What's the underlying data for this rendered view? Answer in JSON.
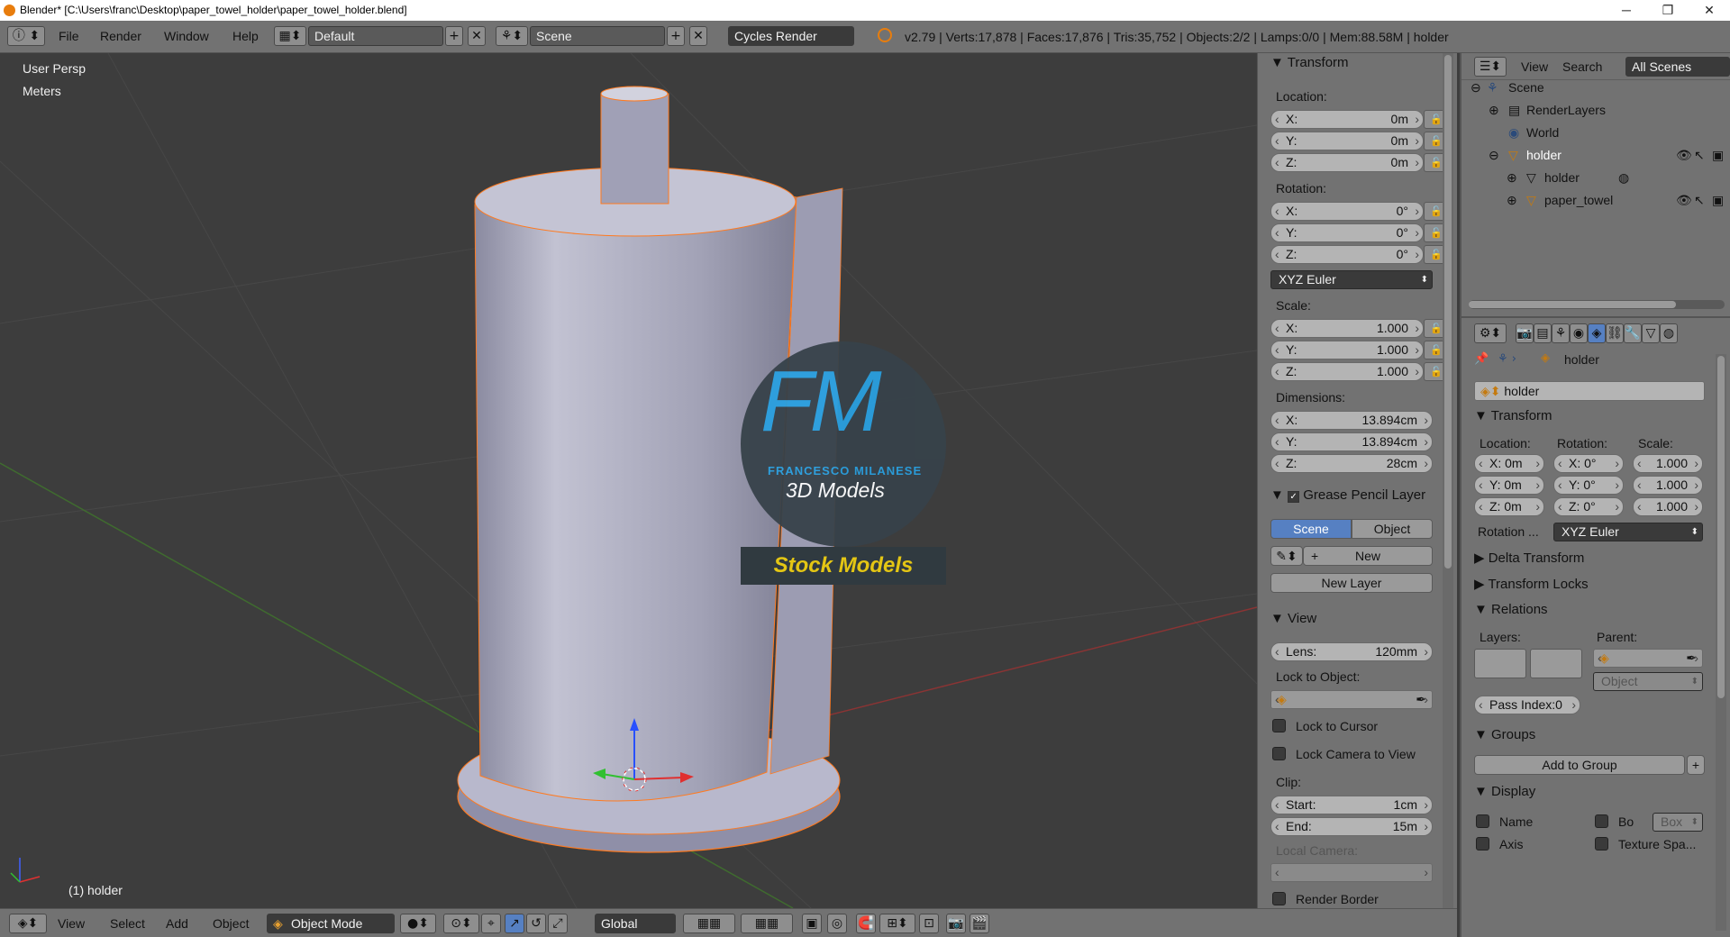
{
  "window": {
    "title": "Blender* [C:\\Users\\franc\\Desktop\\paper_towel_holder\\paper_towel_holder.blend]",
    "minimize": "─",
    "maximize": "❐",
    "close": "✕"
  },
  "topbar": {
    "menus": [
      "File",
      "Render",
      "Window",
      "Help"
    ],
    "layout": "Default",
    "scene": "Scene",
    "engine": "Cycles Render",
    "stats": "v2.79 | Verts:17,878 | Faces:17,876 | Tris:35,752 | Objects:2/2 | Lamps:0/0 | Mem:88.58M | holder"
  },
  "viewport": {
    "view_name": "User Persp",
    "units": "Meters",
    "active_object": "(1) holder",
    "watermark": {
      "initials": "FM",
      "name": "FRANCESCO MILANESE",
      "tagline": "3D Models",
      "banner": "Stock Models"
    }
  },
  "npanel": {
    "transform_title": "Transform",
    "location_label": "Location:",
    "location": [
      {
        "k": "X:",
        "v": "0m"
      },
      {
        "k": "Y:",
        "v": "0m"
      },
      {
        "k": "Z:",
        "v": "0m"
      }
    ],
    "rotation_label": "Rotation:",
    "rotation": [
      {
        "k": "X:",
        "v": "0°"
      },
      {
        "k": "Y:",
        "v": "0°"
      },
      {
        "k": "Z:",
        "v": "0°"
      }
    ],
    "rotation_mode": "XYZ Euler",
    "scale_label": "Scale:",
    "scale": [
      {
        "k": "X:",
        "v": "1.000"
      },
      {
        "k": "Y:",
        "v": "1.000"
      },
      {
        "k": "Z:",
        "v": "1.000"
      }
    ],
    "dimensions_label": "Dimensions:",
    "dimensions": [
      {
        "k": "X:",
        "v": "13.894cm"
      },
      {
        "k": "Y:",
        "v": "13.894cm"
      },
      {
        "k": "Z:",
        "v": "28cm"
      }
    ],
    "grease_title": "Grease Pencil Layer",
    "grease_scene": "Scene",
    "grease_object": "Object",
    "grease_new": "New",
    "grease_new_layer": "New Layer",
    "view_title": "View",
    "lens_label": "Lens:",
    "lens_value": "120mm",
    "lock_object_label": "Lock to Object:",
    "lock_cursor": "Lock to Cursor",
    "lock_camera": "Lock Camera to View",
    "clip_label": "Clip:",
    "clip_start_label": "Start:",
    "clip_start": "1cm",
    "clip_end_label": "End:",
    "clip_end": "15m",
    "local_camera": "Local Camera:",
    "render_border": "Render Border"
  },
  "outliner": {
    "view": "View",
    "search": "Search",
    "filter": "All Scenes",
    "items": [
      "Scene",
      "RenderLayers",
      "World",
      "holder",
      "holder",
      "paper_towel"
    ]
  },
  "props": {
    "object_name": "holder",
    "field_name": "holder",
    "transform_title": "Transform",
    "location_label": "Location:",
    "rotation_label": "Rotation:",
    "scale_label": "Scale:",
    "loc": [
      "X: 0m",
      "Y: 0m",
      "Z: 0m"
    ],
    "rot": [
      "X:  0°",
      "Y:  0°",
      "Z:  0°"
    ],
    "scl": [
      "1.000",
      "1.000",
      "1.000"
    ],
    "rotation_mode_label": "Rotation ...",
    "rotation_mode": "XYZ Euler",
    "delta": "Delta Transform",
    "locks": "Transform Locks",
    "relations": "Relations",
    "layers_label": "Layers:",
    "parent_label": "Parent:",
    "parent_type": "Object",
    "pass_index": "Pass Index:0",
    "groups": "Groups",
    "add_to_group": "Add to Group",
    "display": "Display",
    "name_chk": "Name",
    "bo_chk": "Bo",
    "box_sel": "Box",
    "axis_chk": "Axis",
    "texture_chk": "Texture Spa..."
  },
  "bottombar": {
    "menus": [
      "View",
      "Select",
      "Add",
      "Object"
    ],
    "mode": "Object Mode",
    "orientation": "Global"
  }
}
